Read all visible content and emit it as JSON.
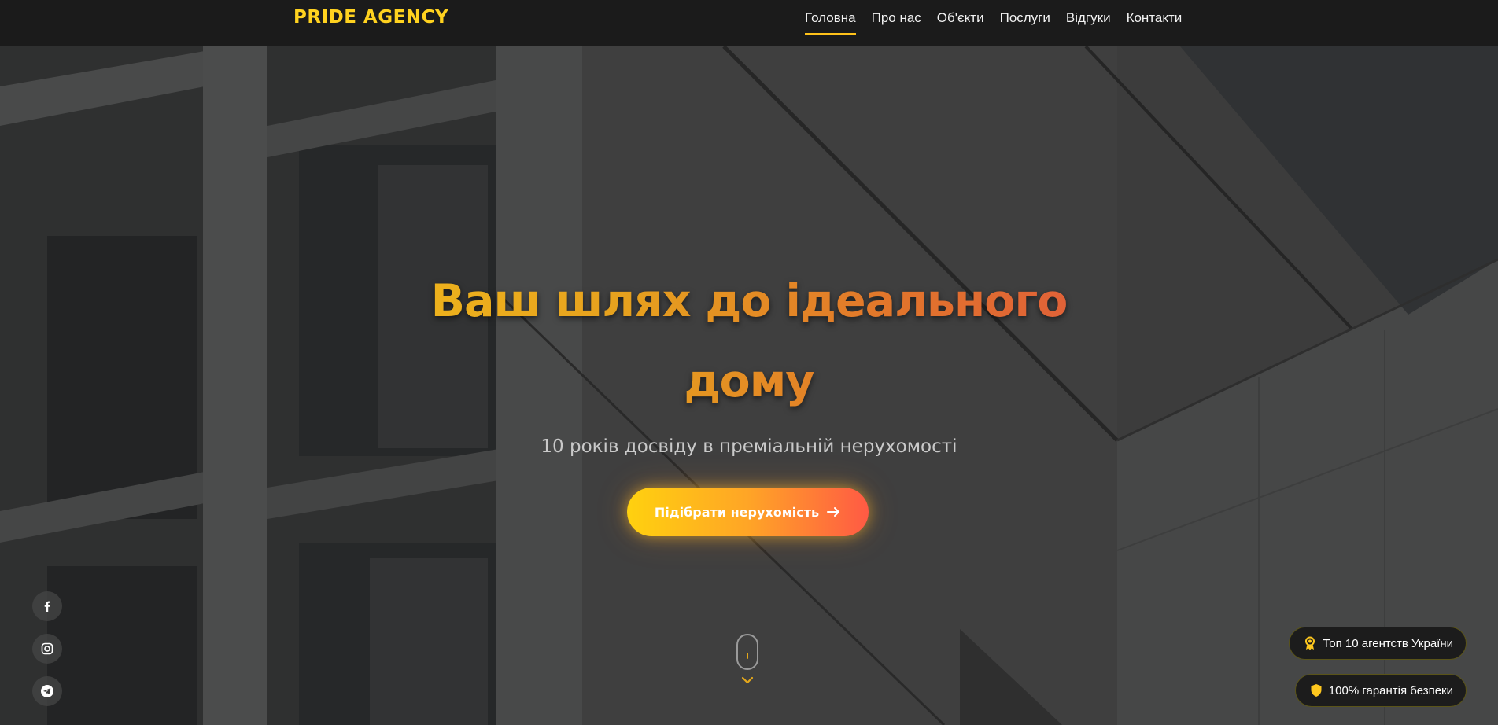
{
  "header": {
    "logo": "PRIDE AGENCY",
    "nav": [
      {
        "label": "Головна",
        "active": true
      },
      {
        "label": "Про нас",
        "active": false
      },
      {
        "label": "Об'єкти",
        "active": false
      },
      {
        "label": "Послуги",
        "active": false
      },
      {
        "label": "Відгуки",
        "active": false
      },
      {
        "label": "Контакти",
        "active": false
      }
    ]
  },
  "hero": {
    "title_line1": "Ваш шлях до ідеального",
    "title_line2": "дому",
    "subtitle": "10 років досвіду в преміальній нерухомості",
    "cta_label": "Підібрати нерухомість"
  },
  "social": [
    {
      "name": "facebook-icon"
    },
    {
      "name": "instagram-icon"
    },
    {
      "name": "telegram-icon"
    }
  ],
  "badges": [
    {
      "label": "Топ 10 агентств України",
      "icon": "award-icon"
    },
    {
      "label": "100% гарантія безпеки",
      "icon": "shield-icon"
    }
  ],
  "colors": {
    "accent": "#ffd21f",
    "header_bg": "#1b1b1b",
    "cta_gradient_start": "#ffd10f",
    "cta_gradient_end": "#ff5a44",
    "title_gradient_start": "#f0b81c",
    "title_gradient_end": "#e05a3d"
  }
}
